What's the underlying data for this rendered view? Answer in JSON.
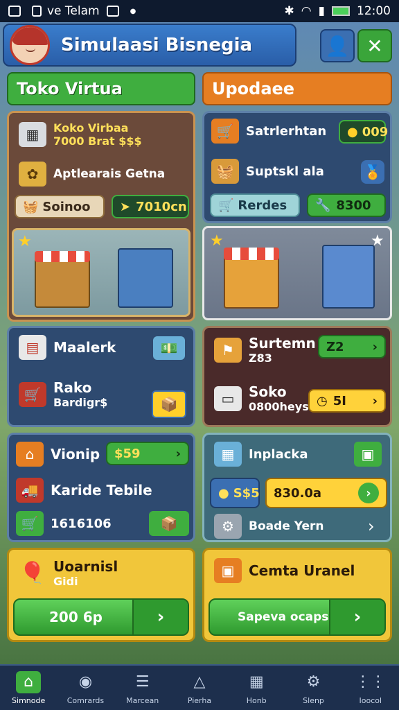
{
  "status": {
    "app": "ve Telam",
    "time": "12:00"
  },
  "header": {
    "title": "Simulaasi Bisnegia"
  },
  "tabs": {
    "left": "Toko Virtua",
    "right": "Upodaee"
  },
  "panel_a": {
    "title": "Koko Virbaa",
    "sub": "7000 Brat $$$",
    "line2": "Aptlearais Getna",
    "btn_left": "Soinoo",
    "btn_right": "7010cn"
  },
  "panel_b": {
    "row1": "Satrlerhtan",
    "row1_val": "009",
    "row2": "Suptskl ala",
    "btn_left": "Rerdes",
    "btn_right": "8300"
  },
  "panel_c": {
    "row1": "Maalerk",
    "row2": "Rako",
    "row2_sub": "Bardigr$"
  },
  "panel_d": {
    "row1": "Surtemn",
    "row1_val": "Z2",
    "row1_sub": "Z83",
    "row2": "Soko",
    "row2_sub": "0800heys",
    "row2_val": "5I"
  },
  "panel_e": {
    "row1": "Vionip",
    "row1_val": "$59",
    "row2": "Karide Tebile",
    "row3": "1616106"
  },
  "panel_f": {
    "row1": "Inplacka",
    "val_left": "S$5",
    "val_right": "830.0a",
    "row3": "Boade Yern"
  },
  "panel_g": {
    "title": "Uoarnisl",
    "sub": "Gidi",
    "btn": "200 6p"
  },
  "panel_h": {
    "title": "Cemta Uranel",
    "btn": "Sapeva ocaps"
  },
  "nav": [
    {
      "label": "Simnode",
      "icon": "home-icon"
    },
    {
      "label": "Comrards",
      "icon": "bag-icon"
    },
    {
      "label": "Marcean",
      "icon": "list-icon"
    },
    {
      "label": "Pierha",
      "icon": "pin-icon"
    },
    {
      "label": "Honb",
      "icon": "store-icon"
    },
    {
      "label": "Slenp",
      "icon": "gear-icon"
    },
    {
      "label": "Ioocol",
      "icon": "grid-icon"
    }
  ]
}
